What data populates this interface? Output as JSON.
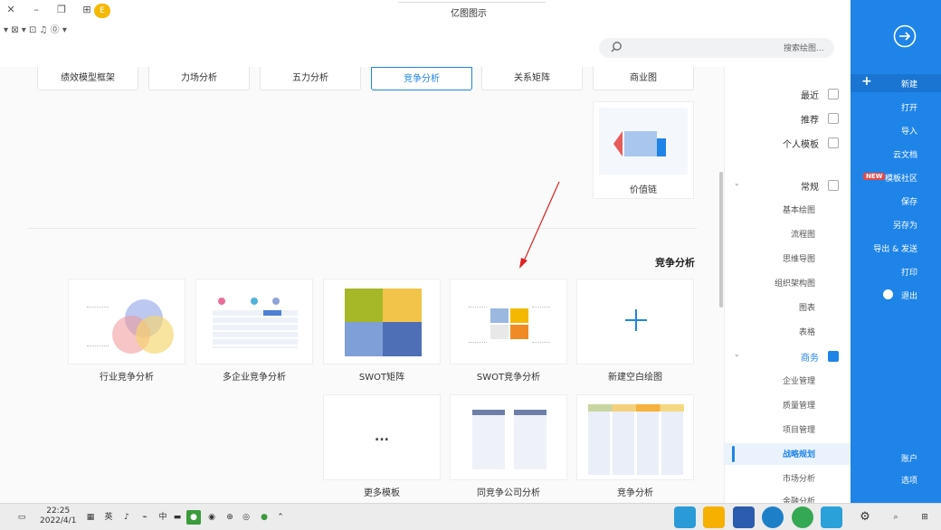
{
  "window": {
    "title": "亿图图示"
  },
  "search": {
    "placeholder": "搜索绘图..."
  },
  "sidebar": {
    "items": [
      {
        "label": "新建"
      },
      {
        "label": "打开"
      },
      {
        "label": "导入"
      },
      {
        "label": "云文档"
      },
      {
        "label": "模板社区",
        "badge": "NEW"
      },
      {
        "label": "保存"
      },
      {
        "label": "另存为"
      },
      {
        "label": "导出 & 发送"
      },
      {
        "label": "打印"
      },
      {
        "label": "退出"
      },
      {
        "label": "账户"
      },
      {
        "label": "选项"
      }
    ]
  },
  "nav": {
    "items": [
      {
        "label": "最近"
      },
      {
        "label": "推荐"
      },
      {
        "label": "个人模板"
      },
      {
        "label": "常规"
      },
      {
        "label": "基本绘图"
      },
      {
        "label": "流程图"
      },
      {
        "label": "思维导图"
      },
      {
        "label": "组织架构图"
      },
      {
        "label": "图表"
      },
      {
        "label": "表格"
      },
      {
        "label": "商务"
      },
      {
        "label": "企业管理"
      },
      {
        "label": "质量管理"
      },
      {
        "label": "项目管理"
      },
      {
        "label": "战略规划"
      },
      {
        "label": "市场分析"
      },
      {
        "label": "金融分析"
      }
    ]
  },
  "tabs": [
    {
      "label": "绩效模型框架"
    },
    {
      "label": "力场分析"
    },
    {
      "label": "五力分析"
    },
    {
      "label": "竞争分析"
    },
    {
      "label": "关系矩阵"
    },
    {
      "label": "商业图"
    }
  ],
  "value_chain_card": {
    "label": "价值链"
  },
  "section": {
    "title": "竞争分析"
  },
  "templates_row1": [
    {
      "label": "新建空白绘图"
    },
    {
      "label": "SWOT竞争分析"
    },
    {
      "label": "SWOT矩阵"
    },
    {
      "label": "多企业竞争分析"
    },
    {
      "label": "行业竞争分析"
    }
  ],
  "templates_row2": [
    {
      "label": "竞争分析"
    },
    {
      "label": "同竞争公司分析"
    },
    {
      "label": "更多模板"
    }
  ],
  "more_dots": "...",
  "taskbar": {
    "time": "22:25",
    "date": "2022/4/1",
    "lang": "英"
  },
  "colors": {
    "accent": "#1f84e8",
    "plus": "#1f84e8"
  }
}
